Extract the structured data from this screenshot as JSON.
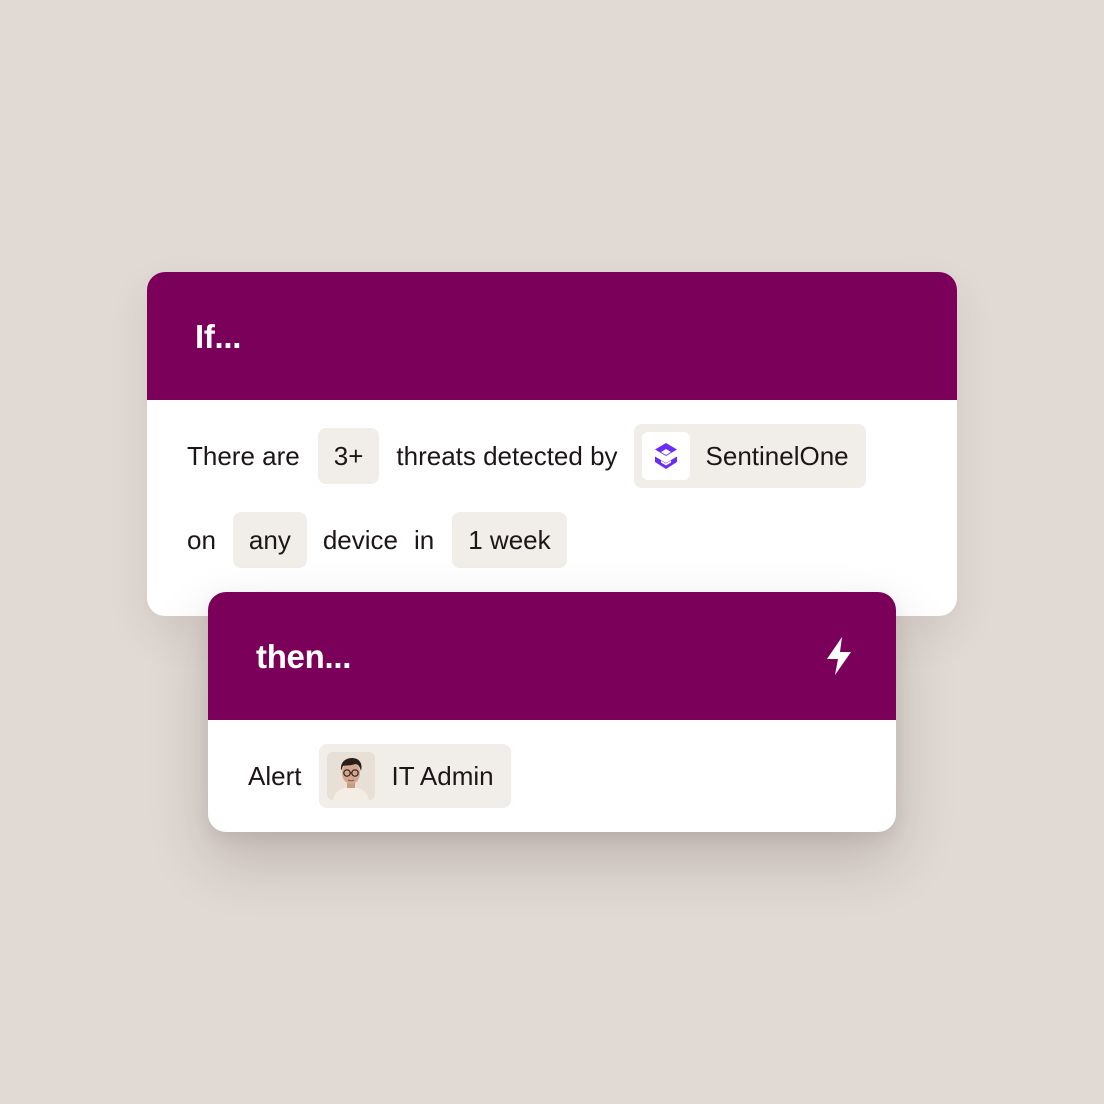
{
  "if_card": {
    "title": "If...",
    "row1": {
      "text_1": "There are",
      "threshold": "3+",
      "text_2": "threats detected by",
      "source": "SentinelOne",
      "source_icon": "sentinelone-logo-icon"
    },
    "row2": {
      "text_1": "on",
      "device_scope": "any",
      "text_2": "device",
      "text_3": "in",
      "period": "1 week"
    }
  },
  "then_card": {
    "title": "then...",
    "action_icon": "lightning-bolt-icon",
    "row1": {
      "text_1": "Alert",
      "recipient": "IT Admin",
      "recipient_icon": "avatar"
    }
  },
  "colors": {
    "background": "#e1d9d3",
    "header": "#7a005a",
    "chip": "#f1ede9",
    "sentinelone_brand": "#6b2cf5"
  }
}
